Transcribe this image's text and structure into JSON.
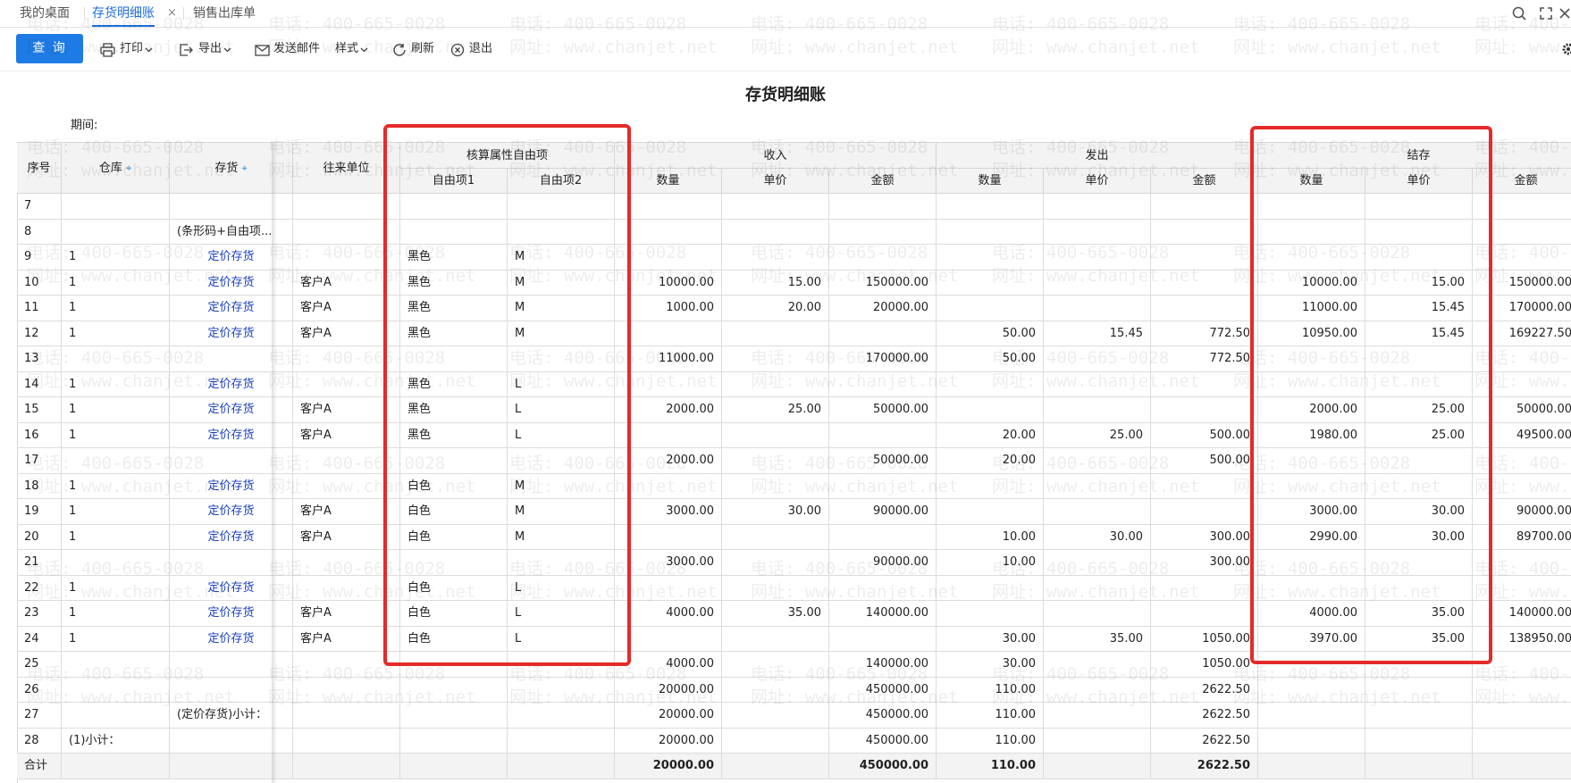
{
  "tabs": [
    {
      "label": "我的桌面"
    },
    {
      "label": "存货明细账",
      "close": "×"
    },
    {
      "label": "销售出库单"
    }
  ],
  "toolbar": {
    "query": "查 询",
    "print": "打印",
    "export": "导出",
    "email": "发送邮件",
    "style": "样式",
    "refresh": "刷新",
    "exit": "退出"
  },
  "report": {
    "title": "存货明细账",
    "period_label": "期间:"
  },
  "headers": {
    "seq": "序号",
    "warehouse": "仓库",
    "inventory": "存货",
    "partner": "往来单位",
    "free_group": "核算属性自由项",
    "free1": "自由项1",
    "free2": "自由项2",
    "income": "收入",
    "issue": "发出",
    "balance": "结存",
    "qty": "数量",
    "price": "单价",
    "amount": "金额"
  },
  "rows": [
    {
      "seq": "7",
      "wh": "",
      "inv": "",
      "partner": "",
      "f1": "",
      "f2": "",
      "in_q": "",
      "in_p": "",
      "in_a": "",
      "out_q": "",
      "out_p": "",
      "out_a": "",
      "bal_q": "",
      "bal_p": "",
      "bal_a": ""
    },
    {
      "seq": "8",
      "wh": "",
      "inv": "(条形码+自由项...",
      "partner": "",
      "f1": "",
      "f2": "",
      "in_q": "",
      "in_p": "",
      "in_a": "",
      "out_q": "",
      "out_p": "",
      "out_a": "",
      "bal_q": "",
      "bal_p": "",
      "bal_a": ""
    },
    {
      "seq": "9",
      "wh": "1",
      "inv": "定价存货",
      "partner": "",
      "f1": "黑色",
      "f2": "M",
      "in_q": "",
      "in_p": "",
      "in_a": "",
      "out_q": "",
      "out_p": "",
      "out_a": "",
      "bal_q": "",
      "bal_p": "",
      "bal_a": ""
    },
    {
      "seq": "10",
      "wh": "1",
      "inv": "定价存货",
      "partner": "客户A",
      "f1": "黑色",
      "f2": "M",
      "in_q": "10000.00",
      "in_p": "15.00",
      "in_a": "150000.00",
      "out_q": "",
      "out_p": "",
      "out_a": "",
      "bal_q": "10000.00",
      "bal_p": "15.00",
      "bal_a": "150000.00"
    },
    {
      "seq": "11",
      "wh": "1",
      "inv": "定价存货",
      "partner": "客户A",
      "f1": "黑色",
      "f2": "M",
      "in_q": "1000.00",
      "in_p": "20.00",
      "in_a": "20000.00",
      "out_q": "",
      "out_p": "",
      "out_a": "",
      "bal_q": "11000.00",
      "bal_p": "15.45",
      "bal_a": "170000.00"
    },
    {
      "seq": "12",
      "wh": "1",
      "inv": "定价存货",
      "partner": "客户A",
      "f1": "黑色",
      "f2": "M",
      "in_q": "",
      "in_p": "",
      "in_a": "",
      "out_q": "50.00",
      "out_p": "15.45",
      "out_a": "772.50",
      "bal_q": "10950.00",
      "bal_p": "15.45",
      "bal_a": "169227.50"
    },
    {
      "seq": "13",
      "wh": "",
      "inv": "",
      "partner": "",
      "f1": "",
      "f2": "",
      "in_q": "11000.00",
      "in_p": "",
      "in_a": "170000.00",
      "out_q": "50.00",
      "out_p": "",
      "out_a": "772.50",
      "bal_q": "",
      "bal_p": "",
      "bal_a": ""
    },
    {
      "seq": "14",
      "wh": "1",
      "inv": "定价存货",
      "partner": "",
      "f1": "黑色",
      "f2": "L",
      "in_q": "",
      "in_p": "",
      "in_a": "",
      "out_q": "",
      "out_p": "",
      "out_a": "",
      "bal_q": "",
      "bal_p": "",
      "bal_a": ""
    },
    {
      "seq": "15",
      "wh": "1",
      "inv": "定价存货",
      "partner": "客户A",
      "f1": "黑色",
      "f2": "L",
      "in_q": "2000.00",
      "in_p": "25.00",
      "in_a": "50000.00",
      "out_q": "",
      "out_p": "",
      "out_a": "",
      "bal_q": "2000.00",
      "bal_p": "25.00",
      "bal_a": "50000.00"
    },
    {
      "seq": "16",
      "wh": "1",
      "inv": "定价存货",
      "partner": "客户A",
      "f1": "黑色",
      "f2": "L",
      "in_q": "",
      "in_p": "",
      "in_a": "",
      "out_q": "20.00",
      "out_p": "25.00",
      "out_a": "500.00",
      "bal_q": "1980.00",
      "bal_p": "25.00",
      "bal_a": "49500.00"
    },
    {
      "seq": "17",
      "wh": "",
      "inv": "",
      "partner": "",
      "f1": "",
      "f2": "",
      "in_q": "2000.00",
      "in_p": "",
      "in_a": "50000.00",
      "out_q": "20.00",
      "out_p": "",
      "out_a": "500.00",
      "bal_q": "",
      "bal_p": "",
      "bal_a": ""
    },
    {
      "seq": "18",
      "wh": "1",
      "inv": "定价存货",
      "partner": "",
      "f1": "白色",
      "f2": "M",
      "in_q": "",
      "in_p": "",
      "in_a": "",
      "out_q": "",
      "out_p": "",
      "out_a": "",
      "bal_q": "",
      "bal_p": "",
      "bal_a": ""
    },
    {
      "seq": "19",
      "wh": "1",
      "inv": "定价存货",
      "partner": "客户A",
      "f1": "白色",
      "f2": "M",
      "in_q": "3000.00",
      "in_p": "30.00",
      "in_a": "90000.00",
      "out_q": "",
      "out_p": "",
      "out_a": "",
      "bal_q": "3000.00",
      "bal_p": "30.00",
      "bal_a": "90000.00"
    },
    {
      "seq": "20",
      "wh": "1",
      "inv": "定价存货",
      "partner": "客户A",
      "f1": "白色",
      "f2": "M",
      "in_q": "",
      "in_p": "",
      "in_a": "",
      "out_q": "10.00",
      "out_p": "30.00",
      "out_a": "300.00",
      "bal_q": "2990.00",
      "bal_p": "30.00",
      "bal_a": "89700.00"
    },
    {
      "seq": "21",
      "wh": "",
      "inv": "",
      "partner": "",
      "f1": "",
      "f2": "",
      "in_q": "3000.00",
      "in_p": "",
      "in_a": "90000.00",
      "out_q": "10.00",
      "out_p": "",
      "out_a": "300.00",
      "bal_q": "",
      "bal_p": "",
      "bal_a": ""
    },
    {
      "seq": "22",
      "wh": "1",
      "inv": "定价存货",
      "partner": "",
      "f1": "白色",
      "f2": "L",
      "in_q": "",
      "in_p": "",
      "in_a": "",
      "out_q": "",
      "out_p": "",
      "out_a": "",
      "bal_q": "",
      "bal_p": "",
      "bal_a": ""
    },
    {
      "seq": "23",
      "wh": "1",
      "inv": "定价存货",
      "partner": "客户A",
      "f1": "白色",
      "f2": "L",
      "in_q": "4000.00",
      "in_p": "35.00",
      "in_a": "140000.00",
      "out_q": "",
      "out_p": "",
      "out_a": "",
      "bal_q": "4000.00",
      "bal_p": "35.00",
      "bal_a": "140000.00"
    },
    {
      "seq": "24",
      "wh": "1",
      "inv": "定价存货",
      "partner": "客户A",
      "f1": "白色",
      "f2": "L",
      "in_q": "",
      "in_p": "",
      "in_a": "",
      "out_q": "30.00",
      "out_p": "35.00",
      "out_a": "1050.00",
      "bal_q": "3970.00",
      "bal_p": "35.00",
      "bal_a": "138950.00"
    },
    {
      "seq": "25",
      "wh": "",
      "inv": "",
      "partner": "",
      "f1": "",
      "f2": "",
      "in_q": "4000.00",
      "in_p": "",
      "in_a": "140000.00",
      "out_q": "30.00",
      "out_p": "",
      "out_a": "1050.00",
      "bal_q": "",
      "bal_p": "",
      "bal_a": ""
    },
    {
      "seq": "26",
      "wh": "",
      "inv": "",
      "partner": "",
      "f1": "",
      "f2": "",
      "in_q": "20000.00",
      "in_p": "",
      "in_a": "450000.00",
      "out_q": "110.00",
      "out_p": "",
      "out_a": "2622.50",
      "bal_q": "",
      "bal_p": "",
      "bal_a": ""
    },
    {
      "seq": "27",
      "wh": "",
      "inv": "(定价存货)小计：",
      "partner": "",
      "f1": "",
      "f2": "",
      "in_q": "20000.00",
      "in_p": "",
      "in_a": "450000.00",
      "out_q": "110.00",
      "out_p": "",
      "out_a": "2622.50",
      "bal_q": "",
      "bal_p": "",
      "bal_a": ""
    },
    {
      "seq": "28",
      "wh": "(1)小计：",
      "inv": "",
      "partner": "",
      "f1": "",
      "f2": "",
      "in_q": "20000.00",
      "in_p": "",
      "in_a": "450000.00",
      "out_q": "110.00",
      "out_p": "",
      "out_a": "2622.50",
      "bal_q": "",
      "bal_p": "",
      "bal_a": ""
    }
  ],
  "total": {
    "label": "合计",
    "in_q": "20000.00",
    "in_a": "450000.00",
    "out_q": "110.00",
    "out_a": "2622.50"
  },
  "watermark": {
    "phone": "电话: 400-665-0028",
    "site": "网址: www.chanjet.net"
  },
  "colors": {
    "accent": "#1e7be6",
    "link": "#1a3fbf",
    "highlight": "#e52a2a"
  }
}
